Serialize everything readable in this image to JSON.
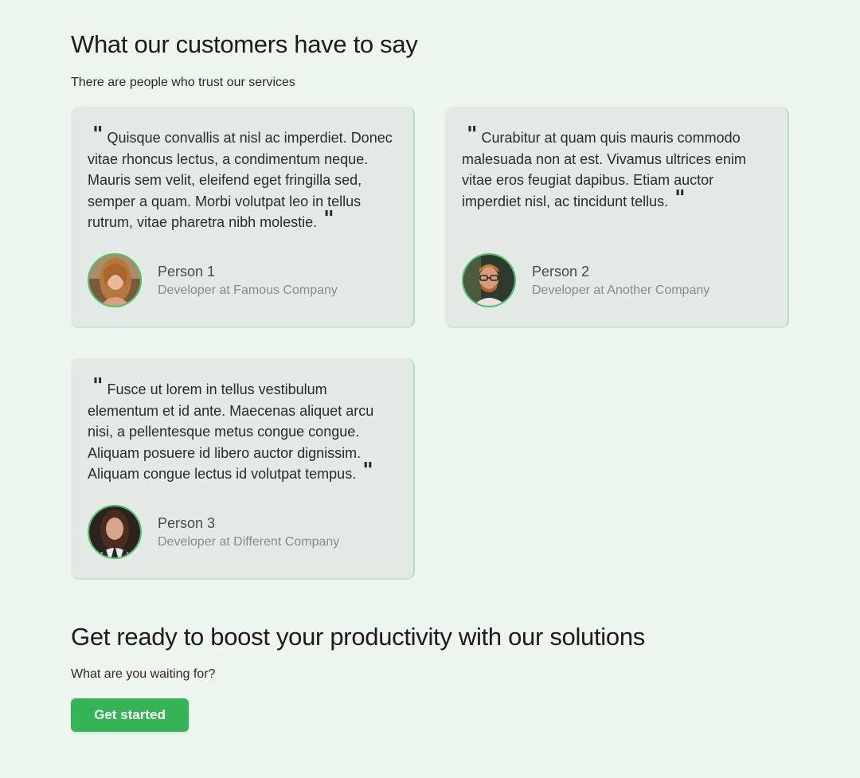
{
  "testimonials_section": {
    "title": "What our customers have to say",
    "subtitle": "There are people who trust our services",
    "items": [
      {
        "quote": "Quisque convallis at nisl ac imperdiet. Donec vitae rhoncus lectus, a condimentum neque. Mauris sem velit, eleifend eget fringilla sed, semper a quam. Morbi volutpat leo in tellus rutrum, vitae pharetra nibh molestie.",
        "name": "Person 1",
        "role": "Developer at Famous Company"
      },
      {
        "quote": "Curabitur at quam quis mauris commodo malesuada non at est. Vivamus ultrices enim vitae eros feugiat dapibus. Etiam auctor imperdiet nisl, ac tincidunt tellus.",
        "name": "Person 2",
        "role": "Developer at Another Company"
      },
      {
        "quote": "Fusce ut lorem in tellus vestibulum elementum et id ante. Maecenas aliquet arcu nisi, a pellentesque metus congue congue. Aliquam posuere id libero auctor dignissim. Aliquam congue lectus id volutpat tempus.",
        "name": "Person 3",
        "role": "Developer at Different Company"
      }
    ]
  },
  "cta_section": {
    "title": "Get ready to boost your productivity with our solutions",
    "subtitle": "What are you waiting for?",
    "button_label": "Get started"
  },
  "colors": {
    "background": "#ecf5ee",
    "card_background": "#e3e9e5",
    "accent": "#34b454",
    "avatar_ring": "#4cc26a"
  },
  "icons": {
    "open_quote": "quote-open-icon",
    "close_quote": "quote-close-icon"
  }
}
